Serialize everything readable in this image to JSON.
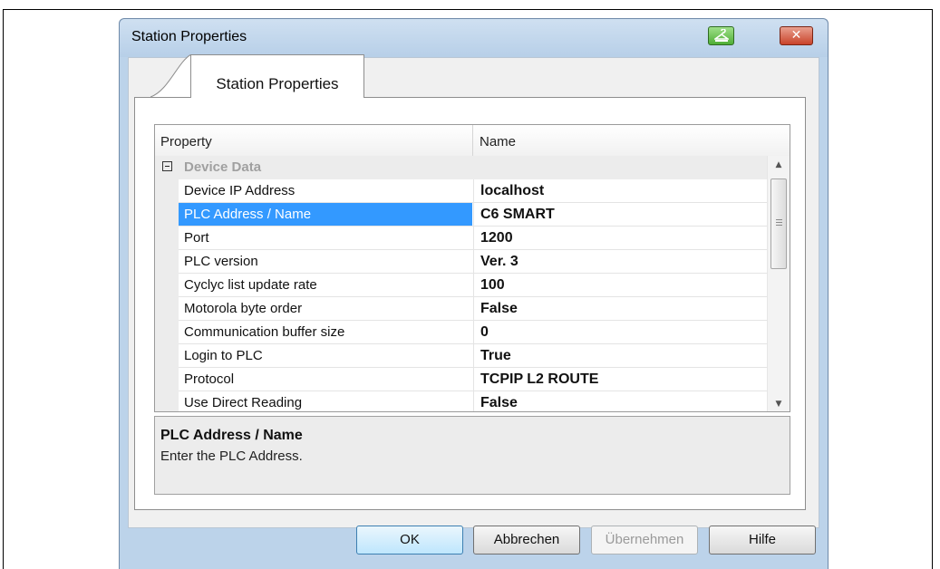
{
  "window": {
    "title": "Station Properties"
  },
  "titlebar_buttons": {
    "close_symbol": "✕",
    "help_icon": "help-hanger-icon"
  },
  "tab": {
    "label": "Station Properties"
  },
  "grid": {
    "columns": [
      "Property",
      "Name"
    ],
    "category": "Device Data",
    "rows": [
      {
        "property": "Device IP Address",
        "value": "localhost"
      },
      {
        "property": "PLC Address / Name",
        "value": "C6 SMART",
        "selected": true
      },
      {
        "property": "Port",
        "value": "1200"
      },
      {
        "property": "PLC version",
        "value": "Ver. 3"
      },
      {
        "property": "Cyclyc list update rate",
        "value": "100"
      },
      {
        "property": "Motorola byte order",
        "value": "False"
      },
      {
        "property": "Communication buffer size",
        "value": "0"
      },
      {
        "property": "Login to PLC",
        "value": "True"
      },
      {
        "property": "Protocol",
        "value": "TCPIP L2 ROUTE"
      },
      {
        "property": "Use Direct Reading",
        "value": "False"
      }
    ],
    "scroll_up_symbol": "▲",
    "scroll_down_symbol": "▼"
  },
  "description": {
    "title": "PLC Address / Name",
    "text": "Enter the PLC Address."
  },
  "buttons": {
    "ok": "OK",
    "cancel": "Abbrechen",
    "apply": "Übernehmen",
    "help": "Hilfe"
  },
  "colors": {
    "selection": "#3399ff",
    "title_bar": "#bcd3ea"
  }
}
